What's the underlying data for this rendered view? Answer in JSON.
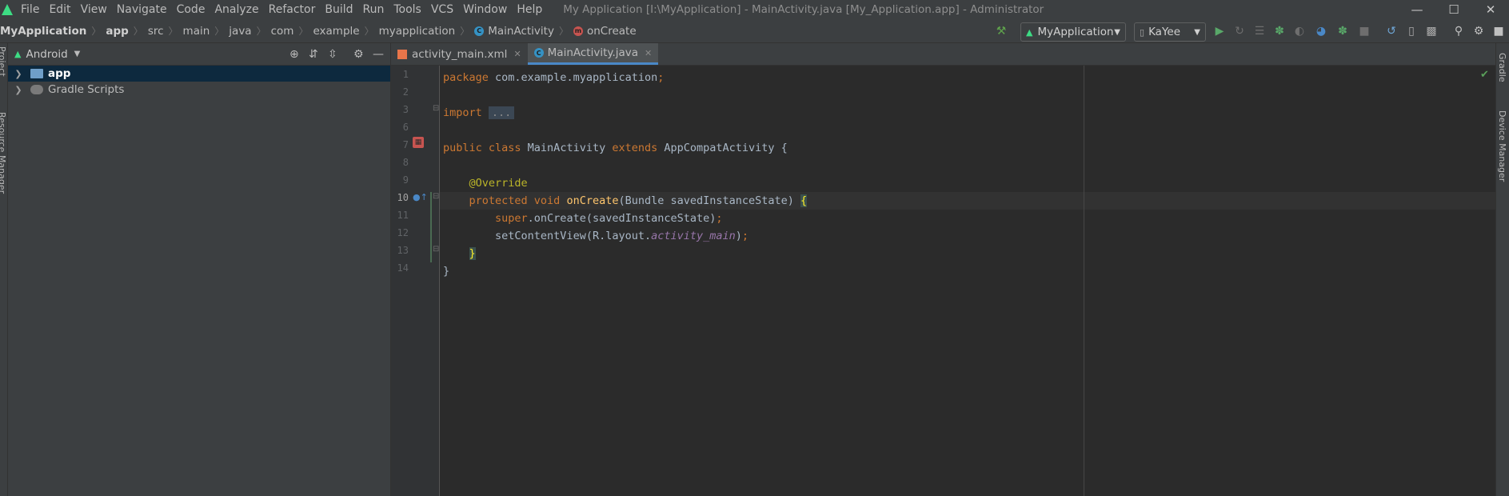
{
  "menubar": {
    "items": [
      {
        "label": "File"
      },
      {
        "label": "Edit"
      },
      {
        "label": "View"
      },
      {
        "label": "Navigate"
      },
      {
        "label": "Code"
      },
      {
        "label": "Analyze"
      },
      {
        "label": "Refactor"
      },
      {
        "label": "Build"
      },
      {
        "label": "Run"
      },
      {
        "label": "Tools"
      },
      {
        "label": "VCS"
      },
      {
        "label": "Window"
      },
      {
        "label": "Help"
      }
    ],
    "window_title": "My Application [I:\\MyApplication] - MainActivity.java [My_Application.app] - Administrator"
  },
  "breadcrumb": [
    "MyApplication",
    "app",
    "src",
    "main",
    "java",
    "com",
    "example",
    "myapplication",
    "MainActivity",
    "onCreate"
  ],
  "toolbar": {
    "run_config": "MyApplication",
    "device": "KaYee"
  },
  "project_panel": {
    "view_mode": "Android",
    "tree": [
      {
        "label": "app",
        "selected": true
      },
      {
        "label": "Gradle Scripts",
        "selected": false
      }
    ],
    "left_tabs": [
      "Project",
      "Resource Manager"
    ]
  },
  "editor": {
    "tabs": [
      {
        "label": "activity_main.xml",
        "active": false
      },
      {
        "label": "MainActivity.java",
        "active": true
      }
    ],
    "line_numbers": [
      "1",
      "2",
      "3",
      "6",
      "7",
      "8",
      "9",
      "10",
      "11",
      "12",
      "13",
      "14"
    ],
    "current_line": "10",
    "code": {
      "l1_kw": "package",
      "l1_rest": " com.example.myapplication",
      "l1_semi": ";",
      "l3_kw": "import",
      "l3_fold": "...",
      "l7_kw1": "public class",
      "l7_name": " MainActivity ",
      "l7_kw2": "extends",
      "l7_rest": " AppCompatActivity {",
      "l9_ann": "@Override",
      "l10_kw": "protected void",
      "l10_fn": " onCreate",
      "l10_rest": "(Bundle savedInstanceState) ",
      "l10_brace": "{",
      "l11_kw": "super",
      "l11_rest": ".onCreate(savedInstanceState)",
      "l11_semi": ";",
      "l12_pre": "setContentView(R.layout.",
      "l12_it": "activity_main",
      "l12_post": ")",
      "l12_semi": ";",
      "l13_brace": "}",
      "l14_brace": "}"
    }
  },
  "right_tabs": [
    "Gradle",
    "Device Manager"
  ],
  "colors": {
    "keyword": "#cc7832",
    "annotation": "#bbb529",
    "function": "#ffc66d",
    "field": "#9876aa",
    "plain": "#a9b7c6"
  }
}
